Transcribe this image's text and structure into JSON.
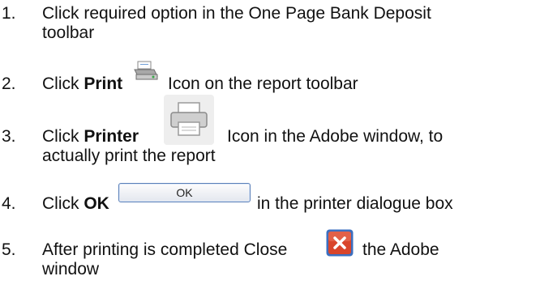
{
  "steps": [
    {
      "number": "1.",
      "line1": "Click required option in the One Page Bank Deposit",
      "line2": "toolbar"
    },
    {
      "number": "2.",
      "prefix": "Click ",
      "bold": "Print",
      "suffix": "Icon on the report toolbar",
      "icon": "print-report-icon"
    },
    {
      "number": "3.",
      "prefix": "Click ",
      "bold": "Printer",
      "suffix": "Icon in the Adobe window, to",
      "line2": "actually print the report",
      "icon": "printer-icon"
    },
    {
      "number": "4.",
      "prefix": "Click ",
      "bold": "OK",
      "button_label": "OK",
      "suffix": "in the printer dialogue box"
    },
    {
      "number": "5.",
      "prefix": "After printing is completed Close",
      "suffix": "the Adobe",
      "line2": "window",
      "icon": "close-icon"
    }
  ],
  "colors": {
    "text": "#111111",
    "close_red": "#d9452b",
    "close_border": "#3b6fc0"
  }
}
